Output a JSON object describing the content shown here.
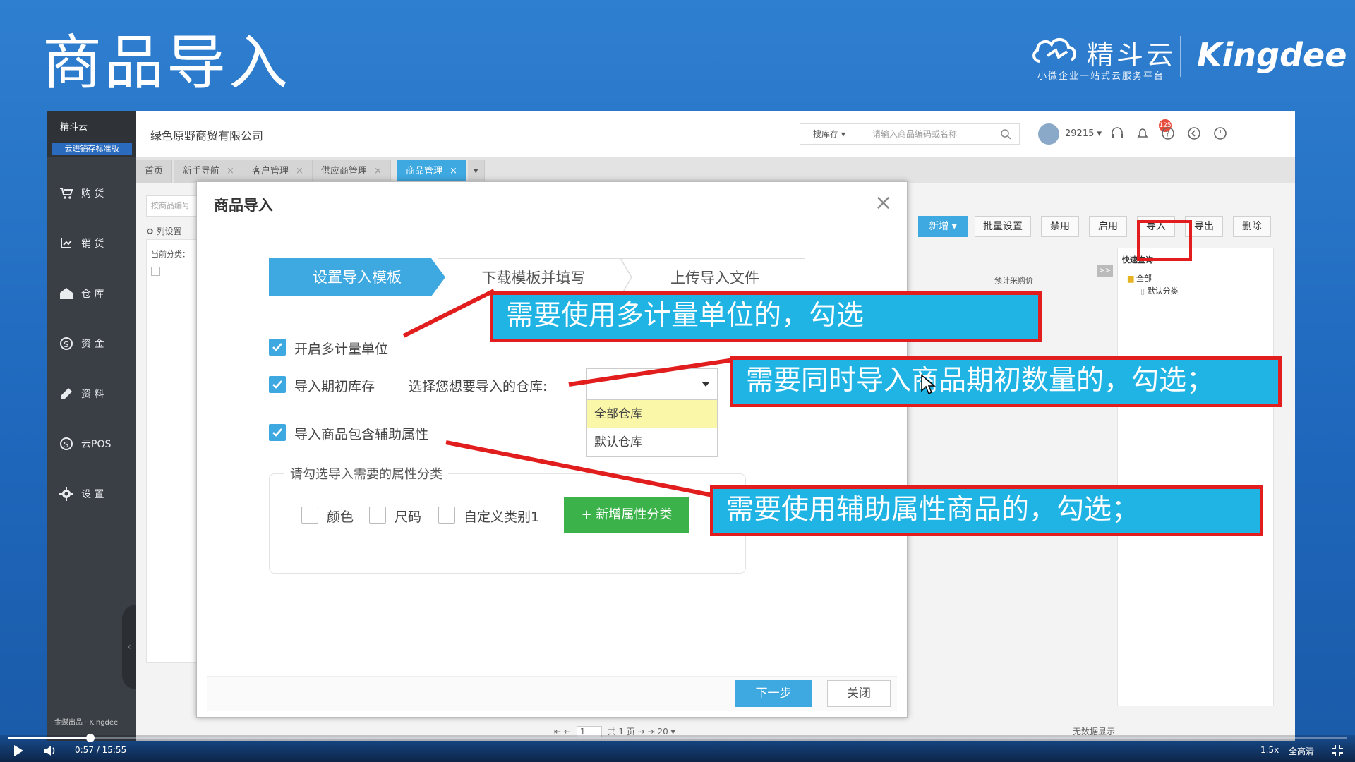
{
  "slide": {
    "title": "商品导入",
    "brand_name": "精斗云",
    "brand_slogan": "小微企业一站式云服务平台",
    "vendor": "Kingdee"
  },
  "sidebar": {
    "logo": "精斗云",
    "edition": "云进销存标准版",
    "items": [
      {
        "label": "购 货",
        "icon": "cart-icon"
      },
      {
        "label": "销 货",
        "icon": "sales-icon"
      },
      {
        "label": "仓 库",
        "icon": "warehouse-icon"
      },
      {
        "label": "资 金",
        "icon": "money-icon"
      },
      {
        "label": "资 料",
        "icon": "pen-icon"
      },
      {
        "label": "云POS",
        "icon": "pos-icon"
      },
      {
        "label": "设 置",
        "icon": "gear-icon"
      }
    ],
    "footer": "金蝶出品 · Kingdee"
  },
  "topbar": {
    "company": "绿色原野商贸有限公司",
    "search_scope": "搜库存",
    "search_placeholder": "请输入商品编码或名称",
    "user_id": "29215",
    "notification_count": "125"
  },
  "tabs": [
    {
      "label": "首页",
      "closable": false
    },
    {
      "label": "新手导航",
      "closable": true
    },
    {
      "label": "客户管理",
      "closable": true
    },
    {
      "label": "供应商管理",
      "closable": true
    },
    {
      "label": "商品管理",
      "closable": true,
      "active": true
    }
  ],
  "content": {
    "filter_placeholder": "按商品编号",
    "column_settings": "列设置",
    "current_category": "当前分类：",
    "column_purchase_price": "预计采购价",
    "quick_query": "快速查询",
    "tree": [
      "全部",
      "默认分类"
    ],
    "buttons": [
      "新增",
      "批量设置",
      "禁用",
      "启用",
      "导入",
      "导出",
      "删除"
    ],
    "pagination": {
      "page": "1",
      "total": "共 1 页",
      "size": "20"
    },
    "no_data": "无数据显示"
  },
  "modal": {
    "title": "商品导入",
    "steps": [
      "设置导入模板",
      "下载模板并填写",
      "上传导入文件"
    ],
    "opt_multi_unit": "开启多计量单位",
    "opt_import_stock": "导入期初库存",
    "warehouse_prompt": "选择您想要导入的仓库:",
    "warehouse_options": [
      "全部仓库",
      "默认仓库"
    ],
    "opt_aux_attr": "导入商品包含辅助属性",
    "attr_section_title": "请勾选导入需要的属性分类",
    "attr_options": [
      "颜色",
      "尺码",
      "自定义类别1"
    ],
    "add_attr_button": "+ 新增属性分类",
    "next_button": "下一步",
    "close_button": "关闭"
  },
  "annotations": [
    "需要使用多计量单位的，勾选",
    "需要同时导入商品期初数量的，勾选；",
    "需要使用辅助属性商品的，勾选；"
  ],
  "player": {
    "time": "0:57 / 15:55",
    "progress": 0.061,
    "speed": "1.5x",
    "quality": "全高清"
  }
}
